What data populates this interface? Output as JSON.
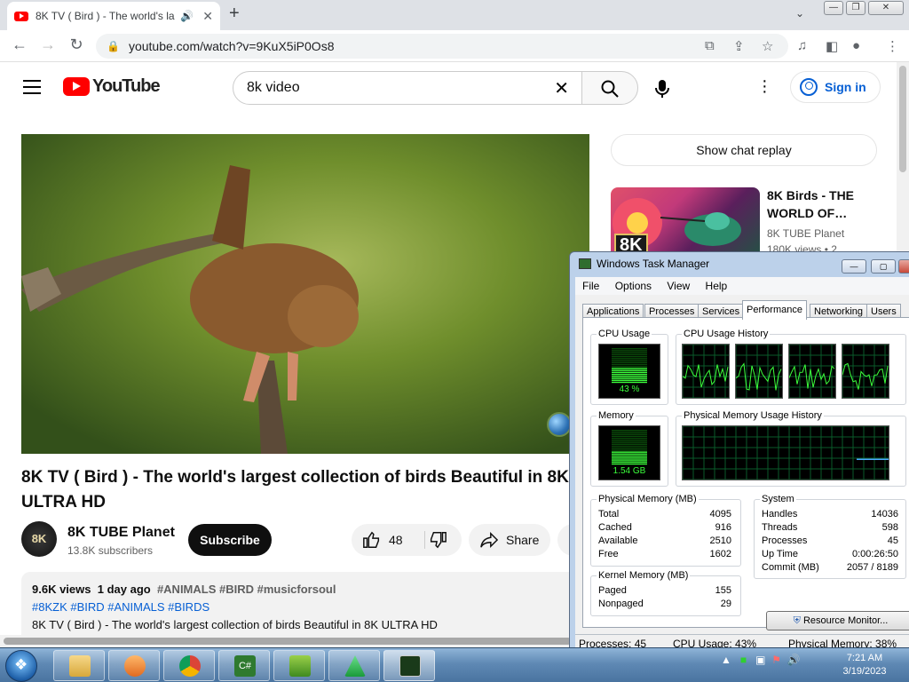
{
  "browser": {
    "tab_title": "8K TV ( Bird ) - The world's la",
    "url": "youtube.com/watch?v=9KuX5iP0Os8"
  },
  "youtube": {
    "logo_text": "YouTube",
    "search_value": "8k video",
    "signin_label": "Sign in",
    "video": {
      "title": "8K TV ( Bird ) - The world's largest collection of birds Beautiful in 8K ULTRA HD",
      "channel_name": "8K TUBE Planet",
      "channel_avatar_text": "8K",
      "subscribers": "13.8K subscribers",
      "subscribe_label": "Subscribe",
      "likes": "48",
      "share_label": "Share",
      "views": "9.6K views",
      "age": "1 day ago",
      "hashtags_line1": "#ANIMALS #BIRD #musicforsoul",
      "hashtags_line2": "#8KZK #BIRD #ANIMALS #BIRDS",
      "description_line": "8K TV ( Bird ) - The world's largest collection of birds Beautiful in 8K ULTRA HD"
    },
    "sidebar": {
      "chat_replay_label": "Show chat replay",
      "rec1_title": "8K Birds - THE WORLD OF…",
      "rec1_channel": "8K TUBE Planet",
      "rec1_meta": "180K views • 2",
      "rec1_badge": "8K"
    }
  },
  "task_manager": {
    "title": "Windows Task Manager",
    "menu": [
      "File",
      "Options",
      "View",
      "Help"
    ],
    "tabs": [
      "Applications",
      "Processes",
      "Services",
      "Performance",
      "Networking",
      "Users"
    ],
    "active_tab": "Performance",
    "cpu_usage_label": "CPU Usage",
    "cpu_usage_value": "43 %",
    "cpu_history_label": "CPU Usage History",
    "memory_label": "Memory",
    "memory_value": "1.54 GB",
    "mem_history_label": "Physical Memory Usage History",
    "physical_memory": {
      "label": "Physical Memory (MB)",
      "rows": [
        [
          "Total",
          "4095"
        ],
        [
          "Cached",
          "916"
        ],
        [
          "Available",
          "2510"
        ],
        [
          "Free",
          "1602"
        ]
      ]
    },
    "kernel_memory": {
      "label": "Kernel Memory (MB)",
      "rows": [
        [
          "Paged",
          "155"
        ],
        [
          "Nonpaged",
          "29"
        ]
      ]
    },
    "system": {
      "label": "System",
      "rows": [
        [
          "Handles",
          "14036"
        ],
        [
          "Threads",
          "598"
        ],
        [
          "Processes",
          "45"
        ],
        [
          "Up Time",
          "0:00:26:50"
        ],
        [
          "Commit (MB)",
          "2057 / 8189"
        ]
      ]
    },
    "resource_monitor_label": "Resource Monitor...",
    "status_processes": "Processes: 45",
    "status_cpu": "CPU Usage: 43%",
    "status_memory": "Physical Memory: 38%",
    "cpu_fraction": 0.43,
    "mem_fraction": 0.38
  },
  "taskbar": {
    "time": "7:21 AM",
    "date": "3/19/2023"
  }
}
